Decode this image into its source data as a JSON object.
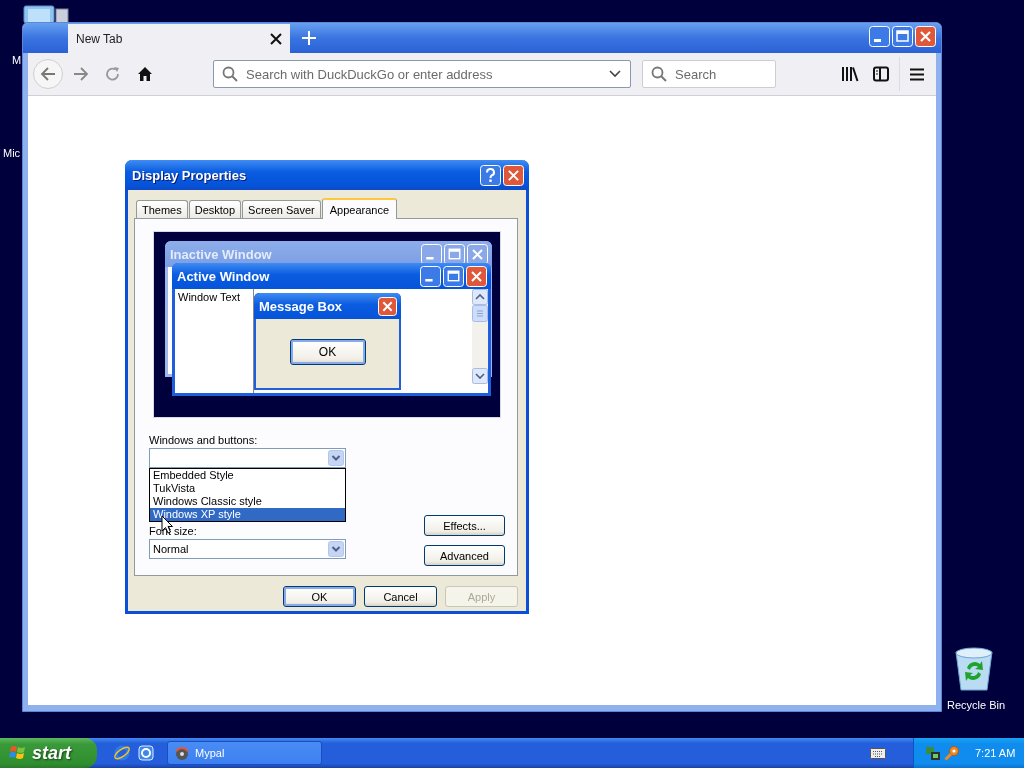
{
  "desktop": {
    "icons": [
      {
        "label": "M",
        "kind": "computer"
      },
      {
        "label": "Mic",
        "kind": "hidden"
      },
      {
        "label": "Recycle Bin",
        "kind": "recycle"
      }
    ]
  },
  "browser": {
    "tabs": [
      {
        "title": "New Tab",
        "selected": true
      }
    ],
    "address_bar": {
      "placeholder": "Search with DuckDuckGo or enter address"
    },
    "search_bar": {
      "placeholder": "Search"
    }
  },
  "dialog": {
    "title": "Display Properties",
    "tabs": [
      {
        "label": "Themes",
        "selected": false
      },
      {
        "label": "Desktop",
        "selected": false
      },
      {
        "label": "Screen Saver",
        "selected": false
      },
      {
        "label": "Appearance",
        "selected": true
      }
    ],
    "preview": {
      "inactive_window": "Inactive Window",
      "active_window": "Active Window",
      "window_text": "Window Text",
      "message_box": "Message Box",
      "message_button": "OK"
    },
    "windows_and_buttons": {
      "label": "Windows and buttons:",
      "expanded": true,
      "options": [
        {
          "label": "Embedded Style",
          "selected": false
        },
        {
          "label": "TukVista",
          "selected": false
        },
        {
          "label": "Windows Classic style",
          "selected": false
        },
        {
          "label": "Windows XP style",
          "selected": true
        }
      ]
    },
    "font_size": {
      "label": "Font size:",
      "value": "Normal"
    },
    "side_buttons": [
      {
        "label": "Effects..."
      },
      {
        "label": "Advanced"
      }
    ],
    "buttons": [
      {
        "label": "OK",
        "disabled": false
      },
      {
        "label": "Cancel",
        "disabled": false
      },
      {
        "label": "Apply",
        "disabled": true
      }
    ]
  },
  "taskbar": {
    "start": "start",
    "tasks": [
      {
        "label": "Mypal"
      }
    ],
    "clock": "7:21 AM"
  }
}
